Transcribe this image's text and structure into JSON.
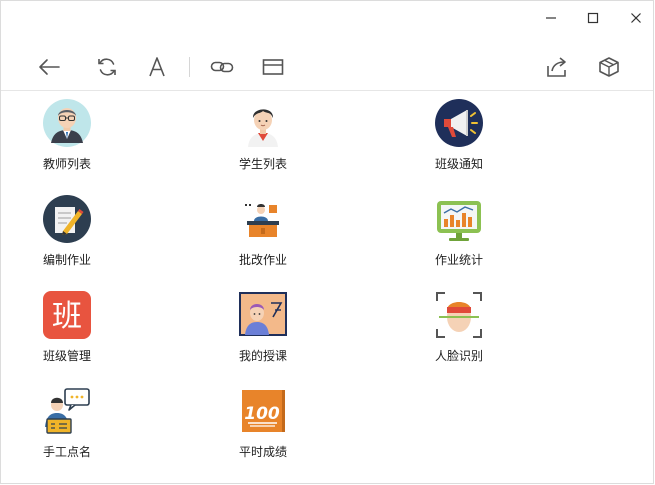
{
  "window_controls": {
    "minimize_icon": "minimize-icon",
    "maximize_icon": "maximize-icon",
    "close_icon": "close-icon"
  },
  "toolbar": {
    "left": [
      "back-arrow-icon",
      "refresh-icon",
      "text-size-icon",
      "link-icon",
      "window-icon"
    ],
    "right": [
      "share-icon",
      "package-icon"
    ]
  },
  "tiles": [
    {
      "label": "教师列表",
      "icon": "teacher-avatar-icon"
    },
    {
      "label": "学生列表",
      "icon": "student-avatar-icon"
    },
    {
      "label": "班级通知",
      "icon": "megaphone-icon"
    },
    {
      "label": "编制作业",
      "icon": "edit-homework-icon"
    },
    {
      "label": "批改作业",
      "icon": "grading-desk-icon"
    },
    {
      "label": "作业统计",
      "icon": "statistics-monitor-icon"
    },
    {
      "label": "班级管理",
      "icon": "class-badge-icon"
    },
    {
      "label": "我的授课",
      "icon": "teaching-board-icon"
    },
    {
      "label": "人脸识别",
      "icon": "face-scan-icon"
    },
    {
      "label": "手工点名",
      "icon": "roll-call-icon"
    },
    {
      "label": "平时成绩",
      "icon": "score-100-icon"
    }
  ],
  "badge_text": "班",
  "score_text": "100",
  "colors": {
    "border": "#dcdcdc",
    "icon_gray": "#555555",
    "badge_red": "#e8543f",
    "navy": "#1f2f5a",
    "orange": "#e8842a"
  }
}
